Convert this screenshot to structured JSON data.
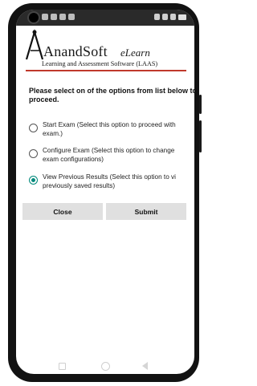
{
  "app": {
    "logo_name": "AnandSoft",
    "logo_tagline": "eLearn",
    "logo_subtitle": "Learning and Assessment Software (LAAS)",
    "accent_color": "#c0392b",
    "radio_color": "#00897b"
  },
  "main": {
    "prompt": "Please select on of the options from list below to proceed.",
    "options": [
      {
        "line1": "Start Exam (Select this option to proceed with",
        "line2": "exam.)",
        "selected": false
      },
      {
        "line1": "Configure Exam (Select this option to change",
        "line2": "exam configurations)",
        "selected": false
      },
      {
        "line1": "View Previous Results (Select this option to vi",
        "line2": "previously saved results)",
        "selected": true
      }
    ]
  },
  "buttons": {
    "close_label": "Close",
    "submit_label": "Submit"
  },
  "navbar": {
    "icons": [
      "recents-square-icon",
      "home-circle-icon",
      "back-triangle-icon"
    ]
  }
}
